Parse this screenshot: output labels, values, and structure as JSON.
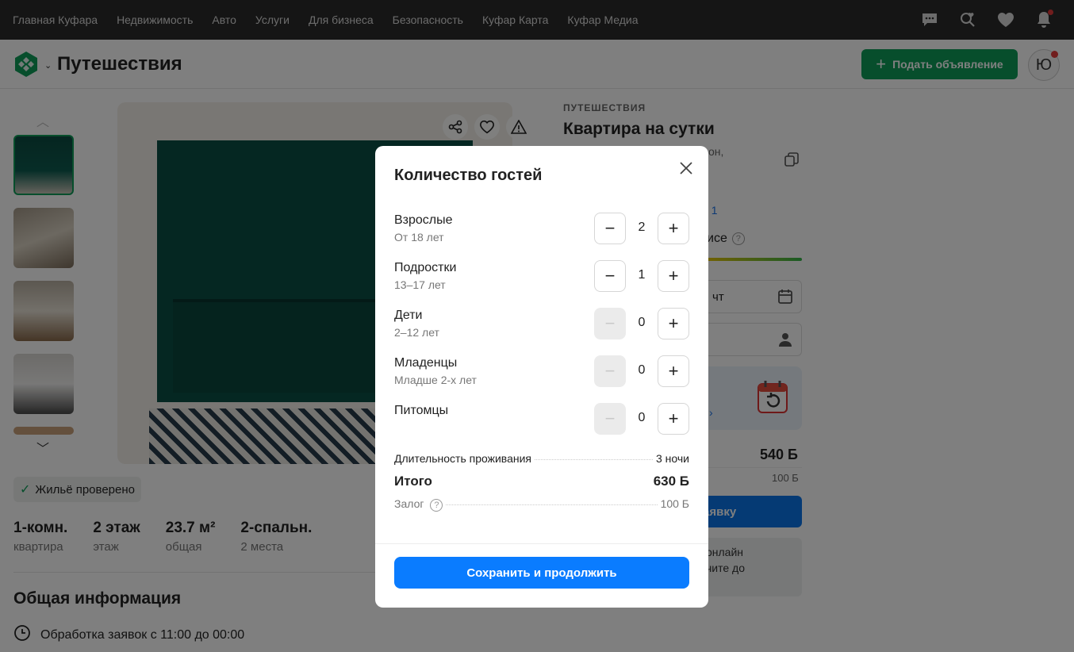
{
  "topnav": {
    "links": [
      "Главная Куфара",
      "Недвижимость",
      "Авто",
      "Услуги",
      "Для бизнеса",
      "Безопасность",
      "Куфар Карта",
      "Куфар Медиа"
    ],
    "icons": [
      "chat-icon",
      "saved-search-icon",
      "heart-icon",
      "bell-icon"
    ]
  },
  "header": {
    "title": "Путешествия",
    "post_button": "Подать объявление",
    "avatar_letter": "Ю"
  },
  "listing": {
    "verified": "Жильё проверено",
    "facts": [
      {
        "value": "1-комн.",
        "label": "квартира"
      },
      {
        "value": "2 этаж",
        "label": "этаж"
      },
      {
        "value": "23.7 м²",
        "label": "общая"
      },
      {
        "value": "2-спальн.",
        "label": "2 места"
      }
    ],
    "general_title": "Общая информация",
    "general_row": "Обработка заявок с 11:00 до 00:00"
  },
  "right": {
    "category": "ПУТЕШЕСТВИЯ",
    "title": "Квартира на сутки",
    "address_fragment": "он,",
    "number_fragment": ": 1",
    "service_fragment": "исе",
    "date_fragment": "чт",
    "promo_arrow": "›",
    "price_fragment": "540 Б",
    "deposit_fragment": "100 Б",
    "button_fragment": "аявку",
    "info_line1": "онлайн",
    "info_line2": "чите до"
  },
  "modal": {
    "title": "Количество гостей",
    "rows": [
      {
        "name": "Взрослые",
        "age": "От 18 лет",
        "value": "2",
        "minus_disabled": false
      },
      {
        "name": "Подростки",
        "age": "13–17 лет",
        "value": "1",
        "minus_disabled": false
      },
      {
        "name": "Дети",
        "age": "2–12 лет",
        "value": "0",
        "minus_disabled": true
      },
      {
        "name": "Младенцы",
        "age": "Младше 2-х лет",
        "value": "0",
        "minus_disabled": true
      },
      {
        "name": "Питомцы",
        "age": "",
        "value": "0",
        "minus_disabled": true
      }
    ],
    "duration_label": "Длительность проживания",
    "duration_value": "3 ночи",
    "total_label": "Итого",
    "total_value": "630 Б",
    "deposit_label": "Залог",
    "deposit_value": "100 Б",
    "save_button": "Сохранить и продолжить"
  },
  "colors": {
    "accent_green": "#0f9d58",
    "primary_blue": "#0a7cff",
    "notification_red": "#e23b3b"
  }
}
